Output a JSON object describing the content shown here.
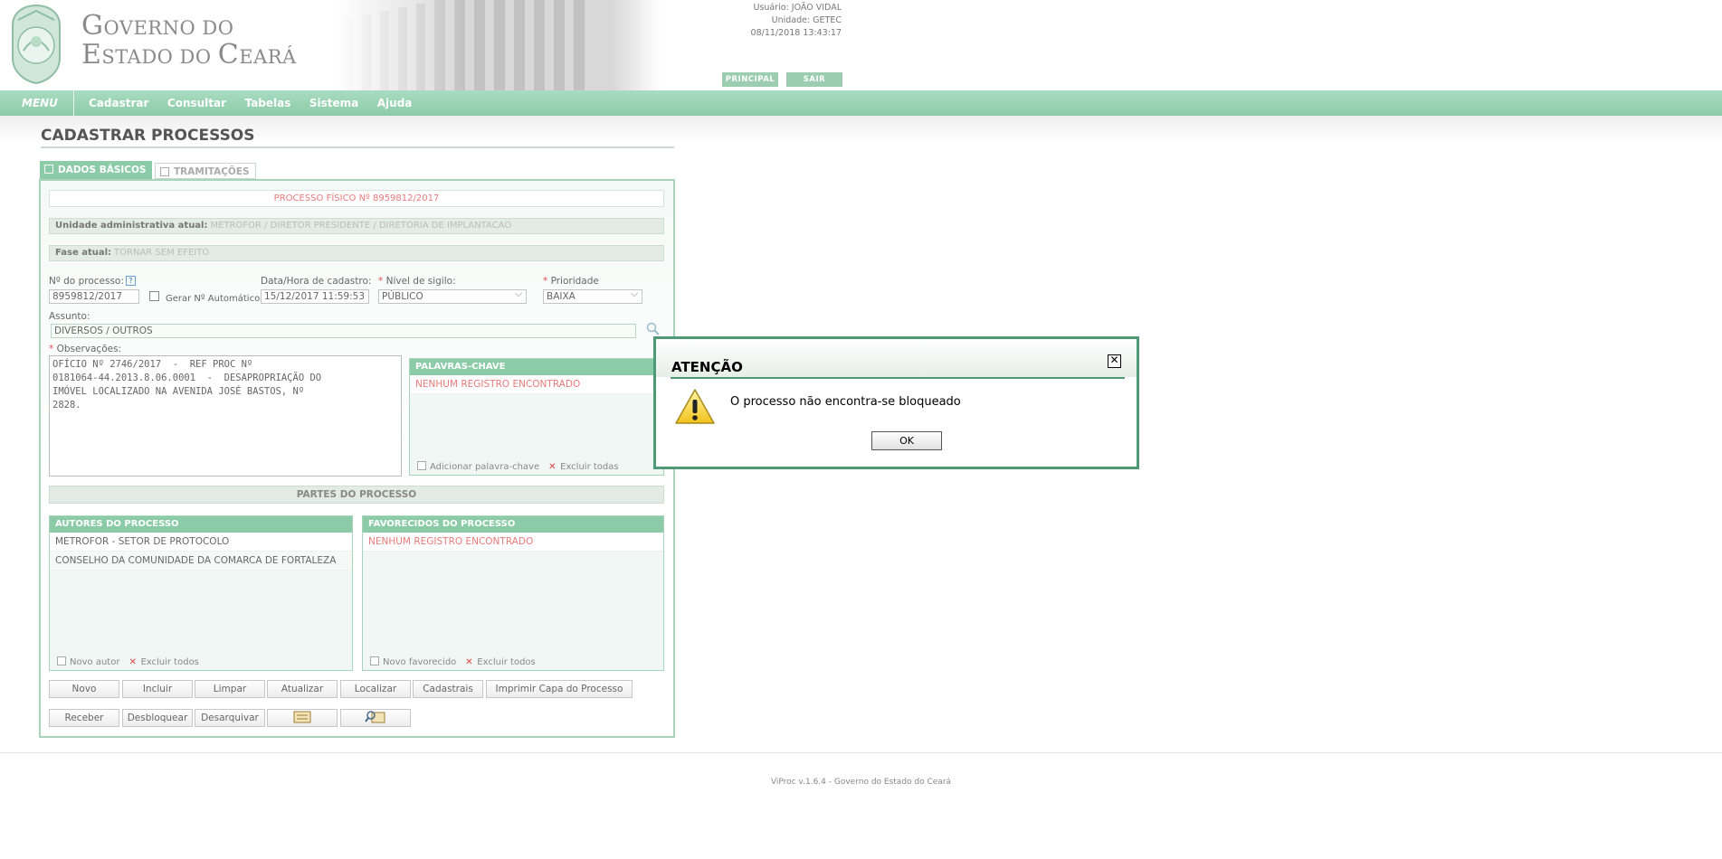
{
  "header": {
    "gov_line1_a": "G",
    "gov_line1_b": "OVERNO DO",
    "gov_line2_a": "E",
    "gov_line2_b": "STADO DO ",
    "gov_line2_c": "C",
    "gov_line2_d": "EARÁ",
    "user": "Usuário: JOÃO VIDAL",
    "unit": "Unidade: GETEC",
    "datetime": "08/11/2018 13:43:17",
    "principal_label": "PRINCIPAL",
    "sair_label": "SAIR"
  },
  "menu": {
    "label": "MENU",
    "items": [
      "Cadastrar",
      "Consultar",
      "Tabelas",
      "Sistema",
      "Ajuda"
    ]
  },
  "page": {
    "title": "CADASTRAR PROCESSOS",
    "tabs": [
      "DADOS BÁSICOS",
      "TRAMITAÇÕES"
    ],
    "process_banner": "PROCESSO FÍSICO Nº 8959812/2017",
    "unit_label": "Unidade administrativa atual:",
    "unit_value": "METROFOR / DIRETOR PRESIDENTE / DIRETORIA DE IMPLANTACAO",
    "phase_label": "Fase atual:",
    "phase_value": "TORNAR SEM EFEITO"
  },
  "form": {
    "num_label": "Nº do processo:",
    "num_value": "8959812/2017",
    "auto_label": "Gerar Nº Automático",
    "date_label": "Data/Hora de cadastro:",
    "date_value": "15/12/2017 11:59:53",
    "sigilo_label": "Nível de sigilo:",
    "sigilo_value": "PÚBLICO",
    "prioridade_label": "Prioridade",
    "prioridade_value": "BAIXA",
    "assunto_label": "Assunto:",
    "assunto_value": "DIVERSOS / OUTROS",
    "obs_label": "Observações:",
    "obs_value": "OFÍCIO Nº 2746/2017  -  REF PROC Nº\n0181064-44.2013.8.06.0001  -  DESAPROPRIAÇÃO DO\nIMÓVEL LOCALIZADO NA AVENIDA JOSÉ BASTOS, Nº\n2828."
  },
  "keywords": {
    "title": "PALAVRAS-CHAVE",
    "empty": "NENHUM REGISTRO ENCONTRADO",
    "add_label": "Adicionar palavra-chave",
    "delete_label": "Excluir todas"
  },
  "partes": {
    "title": "PARTES DO PROCESSO",
    "autores_title": "AUTORES DO PROCESSO",
    "autores": [
      "METROFOR - SETOR DE PROTOCOLO",
      "CONSELHO DA COMUNIDADE DA COMARCA DE FORTALEZA"
    ],
    "novo_autor": "Novo autor",
    "excluir_autores": "Excluir todos",
    "favorecidos_title": "FAVORECIDOS DO PROCESSO",
    "favorecidos_empty": "NENHUM REGISTRO ENCONTRADO",
    "novo_favorecido": "Novo favorecido",
    "excluir_favorecidos": "Excluir todos"
  },
  "buttons": {
    "row1": [
      "Novo",
      "Incluir",
      "Limpar",
      "Atualizar",
      "Localizar",
      "Cadastrais",
      "Imprimir Capa do Processo"
    ],
    "row2": [
      "Receber",
      "Desbloquear",
      "Desarquivar"
    ]
  },
  "footer": {
    "text": "ViProc v.1.6.4 - Governo do Estado do Ceará"
  },
  "modal": {
    "title": "ATENÇÃO",
    "message": "O processo não encontra-se bloqueado",
    "ok": "OK"
  },
  "icons": {
    "warning": "warning-icon",
    "close": "close-icon",
    "help": "help-icon",
    "search": "search-icon"
  },
  "colors": {
    "brand_green": "#8ccba8",
    "dialog_border": "#4e9a76",
    "empty_red": "#e87a7a"
  }
}
